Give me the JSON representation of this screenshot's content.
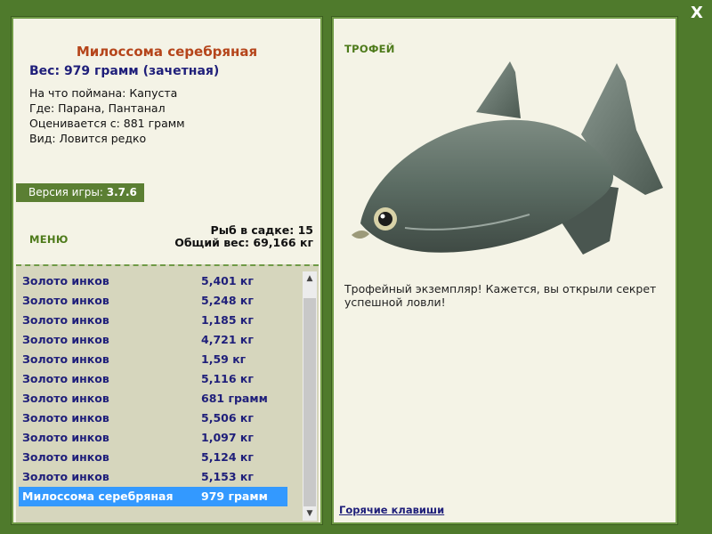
{
  "close_label": "X",
  "fish": {
    "title": "Милоссома серебряная",
    "weight_line": "Вес: 979 грамм (зачетная)",
    "info": [
      "На что поймана: Капуста",
      "Где: Парана, Пантанал",
      "Оценивается с: 881 грамм",
      "Вид: Ловится редко"
    ]
  },
  "version": {
    "label": "Версия игры:",
    "value": "3.7.6"
  },
  "menu_label": "МЕНЮ",
  "keep": {
    "count_line": "Рыб в садке: 15",
    "total_line": "Общий вес: 69,166 кг"
  },
  "catch_list": [
    {
      "name": "Золото инков",
      "weight": "5,401 кг"
    },
    {
      "name": "Золото инков",
      "weight": "5,248 кг"
    },
    {
      "name": "Золото инков",
      "weight": "1,185 кг"
    },
    {
      "name": "Золото инков",
      "weight": "4,721 кг"
    },
    {
      "name": "Золото инков",
      "weight": "1,59 кг"
    },
    {
      "name": "Золото инков",
      "weight": "5,116 кг"
    },
    {
      "name": "Золото инков",
      "weight": "681 грамм"
    },
    {
      "name": "Золото инков",
      "weight": "5,506 кг"
    },
    {
      "name": "Золото инков",
      "weight": "1,097 кг"
    },
    {
      "name": "Золото инков",
      "weight": "5,124 кг"
    },
    {
      "name": "Золото инков",
      "weight": "5,153 кг"
    },
    {
      "name": "Милоссома серебряная",
      "weight": "979 грамм",
      "selected": true
    }
  ],
  "trophy": {
    "label": "ТРОФЕЙ",
    "text": "Трофейный экземпляр! Кажется, вы открыли секрет успешной ловли!"
  },
  "hotkeys_label": "Горячие клавиши",
  "icons": {
    "scroll_up": "scroll-up-arrow-icon",
    "scroll_down": "scroll-down-arrow-icon",
    "fish_picture": "silver-dollar-fish-image"
  },
  "colors": {
    "background": "#4f7a2c",
    "panel": "#f4f3e6",
    "title": "#b5451b",
    "accent_text": "#1f1f7a",
    "selection": "#3399ff"
  }
}
